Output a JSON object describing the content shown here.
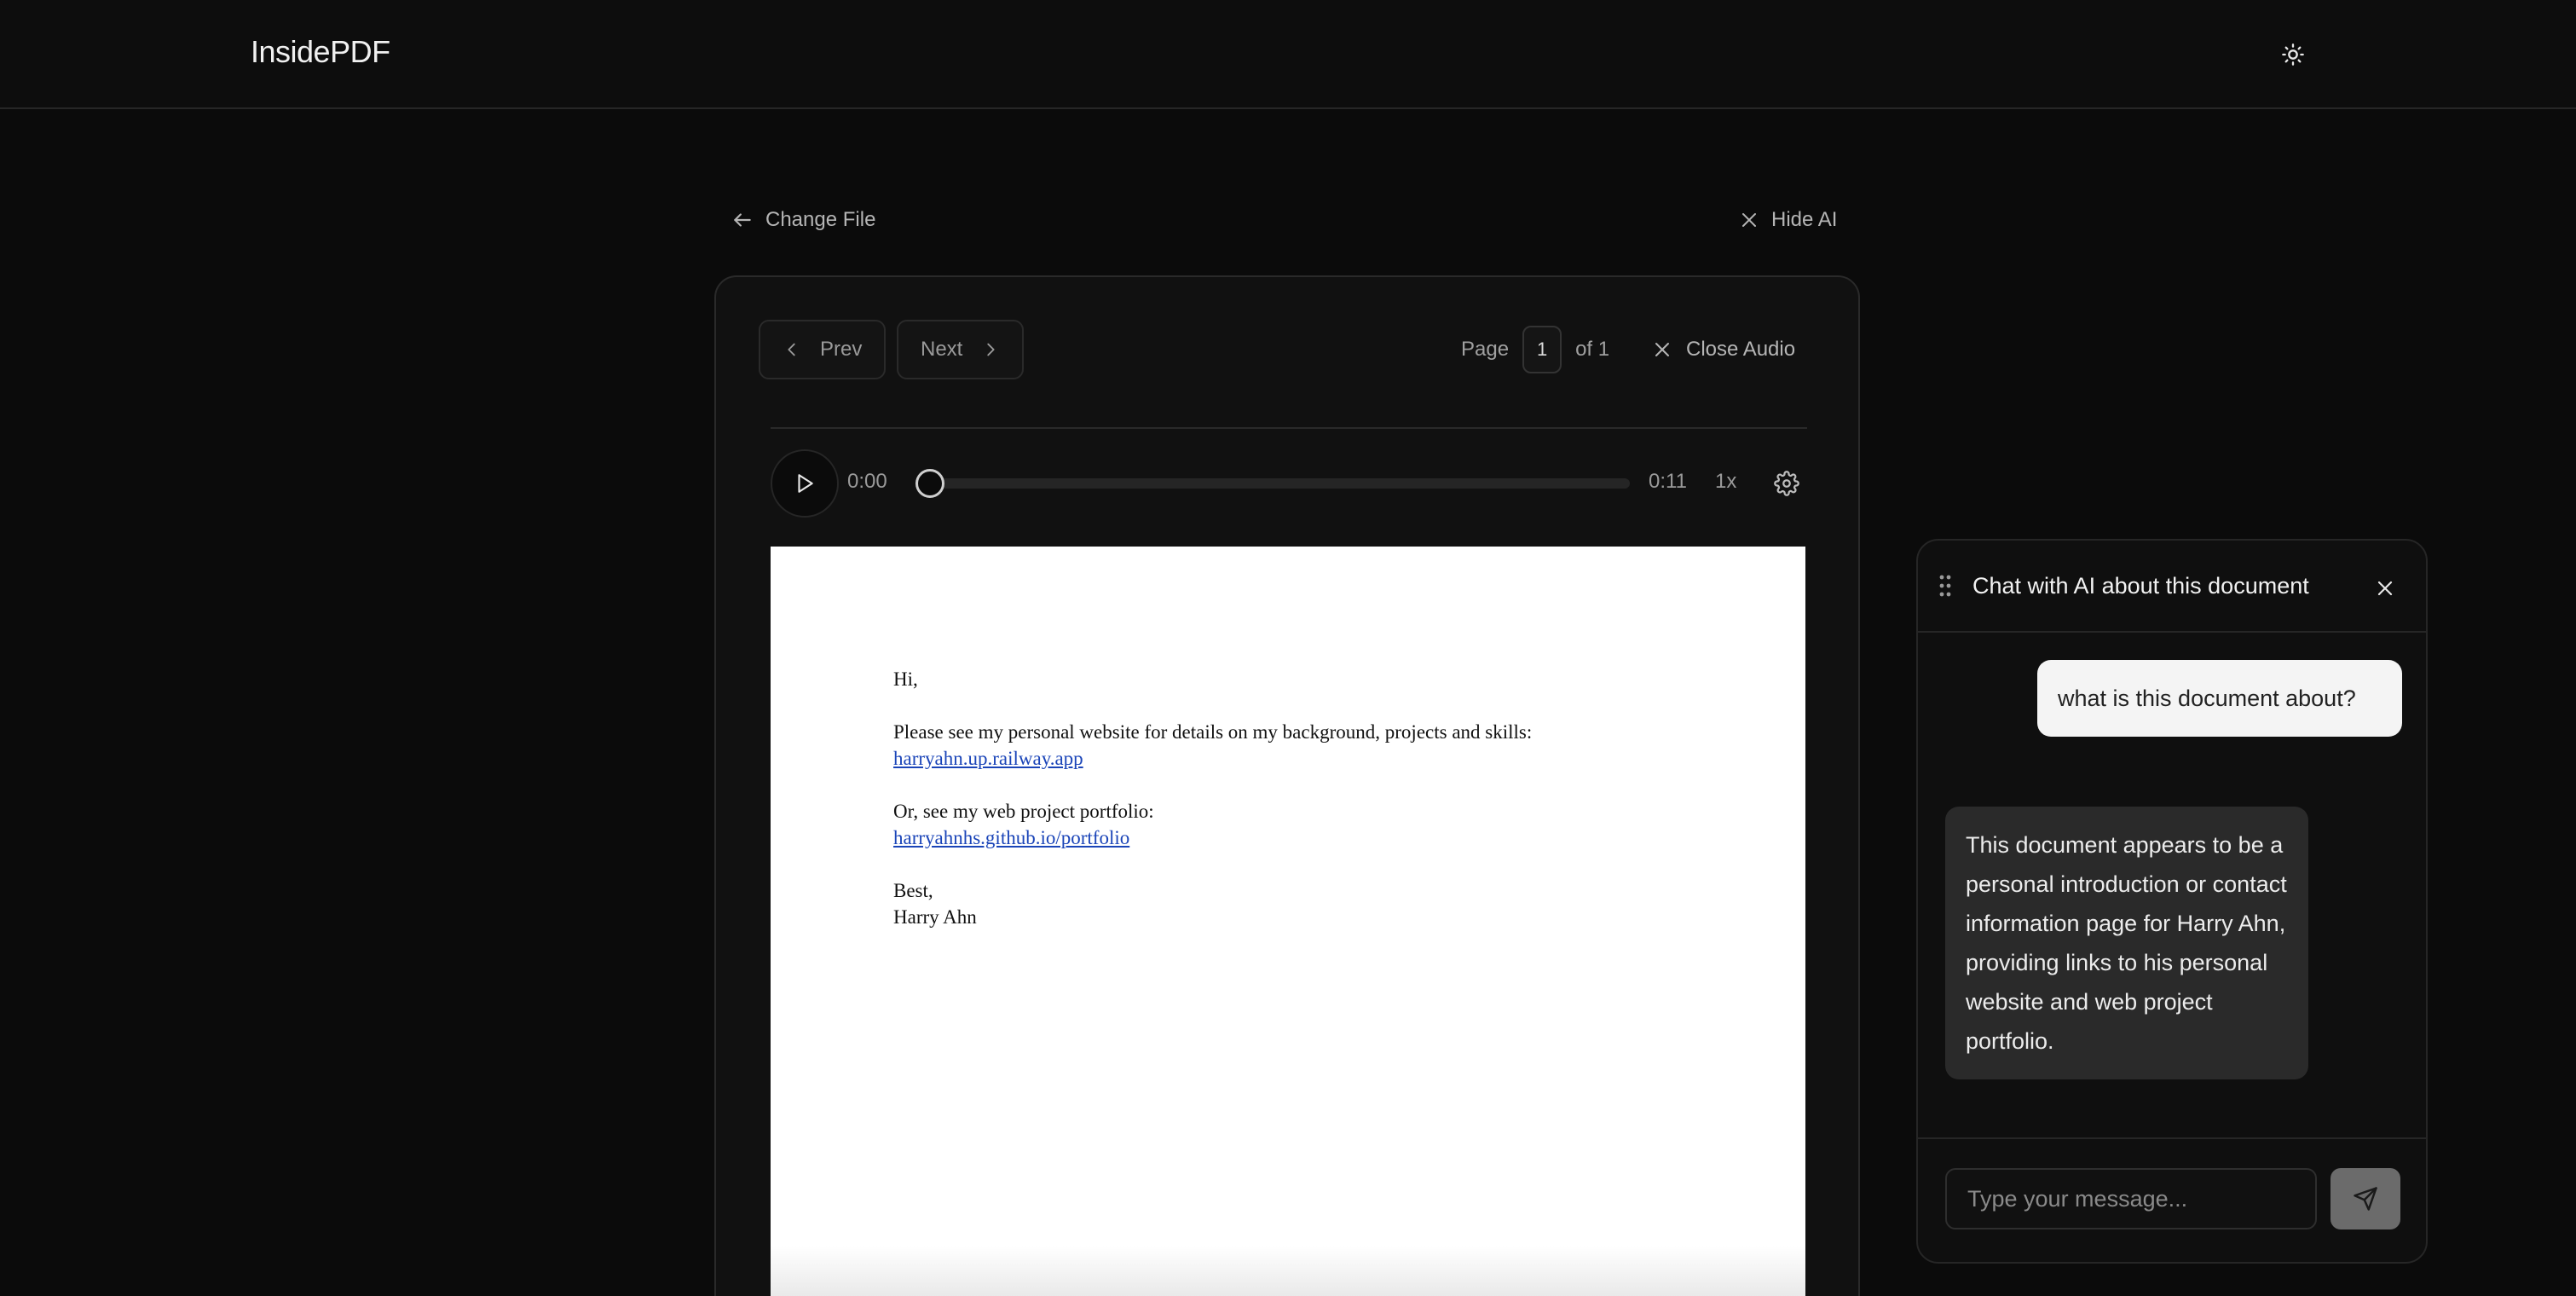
{
  "app": {
    "logo": "InsidePDF",
    "theme_icon": "sun-icon"
  },
  "actions": {
    "change_file": "Change File",
    "hide_ai": "Hide AI"
  },
  "viewer": {
    "prev_label": "Prev",
    "next_label": "Next",
    "page_label": "Page",
    "page_value": "1",
    "of_label": "of 1",
    "close_audio": "Close Audio"
  },
  "audio": {
    "current_time": "0:00",
    "total_time": "0:11",
    "speed": "1x",
    "progress": 0
  },
  "pdf": {
    "greeting": "Hi,",
    "line1": "Please see my personal website for details on my background, projects and skills:",
    "link1": "harryahn.up.railway.app",
    "line2": "Or, see my web project portfolio:",
    "link2": "harryahnhs.github.io/portfolio",
    "closing": "Best,",
    "signature": "Harry Ahn"
  },
  "chat": {
    "title": "Chat with AI about this document",
    "messages": [
      {
        "role": "user",
        "text": "what is this document about?"
      },
      {
        "role": "assistant",
        "text": "This document appears to be a personal introduction or contact information page for Harry Ahn, providing links to his personal website and web project portfolio."
      }
    ],
    "input_placeholder": "Type your message..."
  },
  "colors": {
    "background": "#0b0b0b",
    "card": "#111111",
    "border": "#2a2a2a",
    "link": "#1a44b8",
    "user_bubble": "#f4f4f4",
    "ai_bubble": "#2a2a2a",
    "send_button": "#6b6b6b"
  }
}
